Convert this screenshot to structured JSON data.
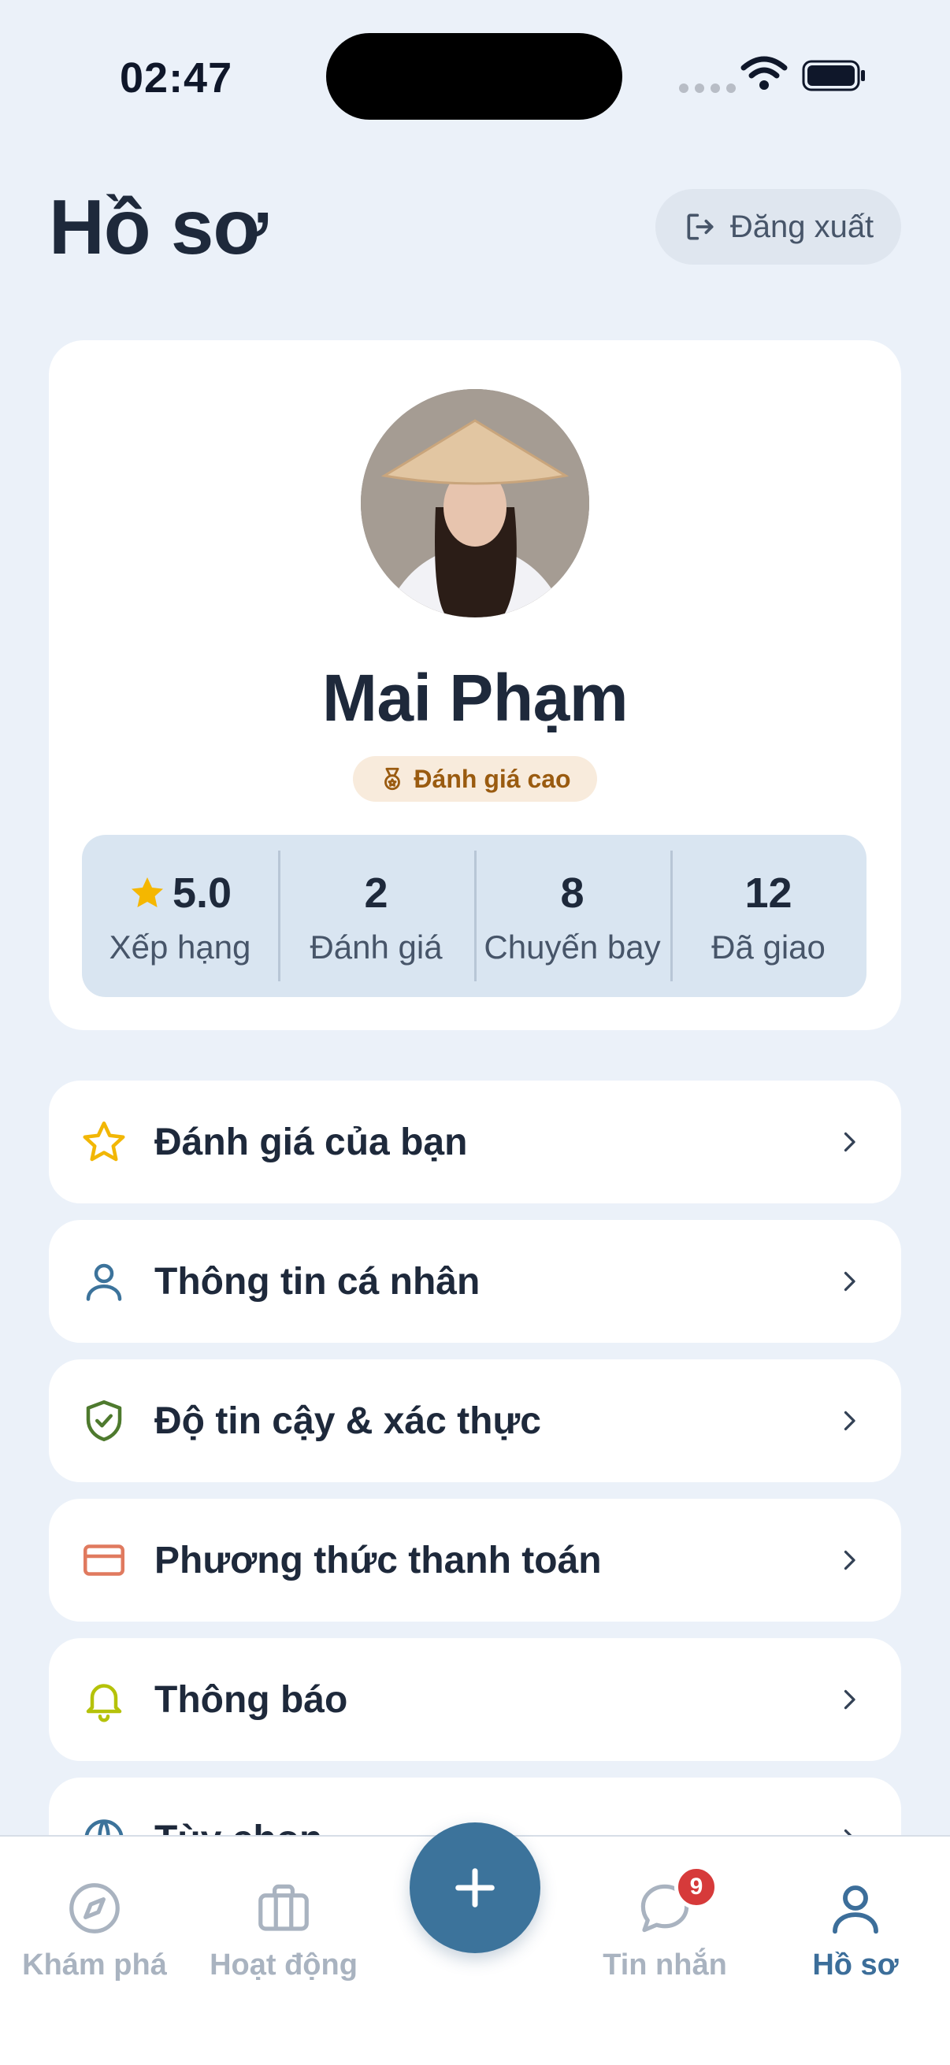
{
  "status_bar": {
    "time": "02:47"
  },
  "header": {
    "title": "Hồ sơ",
    "logout_label": "Đăng xuất"
  },
  "profile": {
    "name": "Mai Phạm",
    "badge_label": "Đánh giá cao",
    "stats": [
      {
        "value": "5.0",
        "label": "Xếp hạng",
        "icon": "star-icon"
      },
      {
        "value": "2",
        "label": "Đánh giá"
      },
      {
        "value": "8",
        "label": "Chuyến bay"
      },
      {
        "value": "12",
        "label": "Đã giao"
      }
    ]
  },
  "menu": [
    {
      "label": "Đánh giá của bạn",
      "icon": "star-outline-icon",
      "color": "#F2B705"
    },
    {
      "label": "Thông tin cá nhân",
      "icon": "user-icon",
      "color": "#3C739B"
    },
    {
      "label": "Độ tin cậy & xác thực",
      "icon": "shield-check-icon",
      "color": "#4E7A2E"
    },
    {
      "label": "Phương thức thanh toán",
      "icon": "credit-card-icon",
      "color": "#E07A5F"
    },
    {
      "label": "Thông báo",
      "icon": "bell-icon",
      "color": "#B5C20A"
    },
    {
      "label": "Tùy chọn",
      "icon": "globe-icon",
      "color": "#3C739B"
    }
  ],
  "bottom_nav": {
    "items": [
      {
        "label": "Khám phá",
        "icon": "compass-icon"
      },
      {
        "label": "Hoạt động",
        "icon": "briefcase-icon"
      },
      {
        "label": "Tin nhắn",
        "icon": "chat-icon",
        "badge": "9"
      },
      {
        "label": "Hồ sơ",
        "icon": "user-icon",
        "active": true
      }
    ],
    "fab_icon": "plus-icon"
  },
  "colors": {
    "accent": "#3C739B",
    "background": "#EBF1F9",
    "badge_red": "#D63A3A"
  }
}
